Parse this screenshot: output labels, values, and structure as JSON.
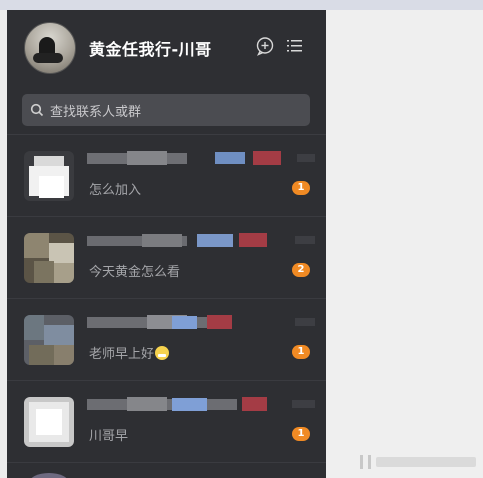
{
  "header": {
    "title": "黄金任我行-川哥",
    "add_icon": "add-chat-icon",
    "menu_icon": "list-menu-icon"
  },
  "search": {
    "placeholder": "查找联系人或群"
  },
  "conversations": [
    {
      "last_message": "怎么加入",
      "unread": "1"
    },
    {
      "last_message": "今天黄金怎么看",
      "unread": "2"
    },
    {
      "last_message": "老师早上好",
      "unread": "1",
      "has_emoji": true
    },
    {
      "last_message": "川哥早",
      "unread": "1"
    }
  ],
  "colors": {
    "panel_bg": "#2e2f33",
    "search_bg": "#4b4c51",
    "badge": "#f08a24",
    "right_pane": "#efefef"
  }
}
